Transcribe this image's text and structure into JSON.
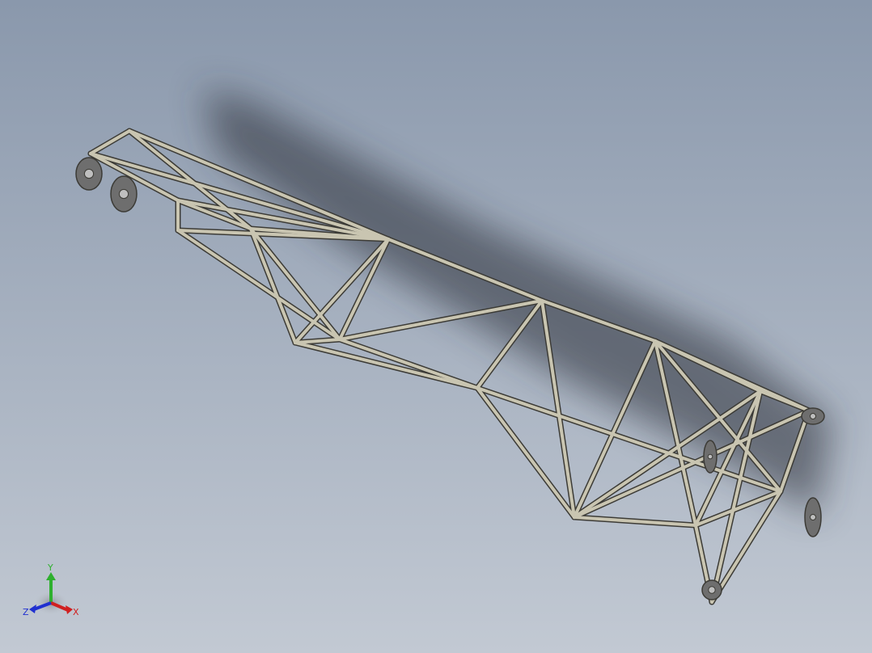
{
  "viewport": {
    "background_top": "#8a98ac",
    "background_bottom": "#c2c9d3"
  },
  "model": {
    "tube_color": "#c9c5b1",
    "tube_edge": "#3c3b36",
    "plate_color": "#6e6e6e"
  },
  "triad": {
    "y_label": "Y",
    "x_label": "X",
    "z_label": "Z",
    "y_color": "#2fb02f",
    "x_color": "#d02020",
    "z_color": "#2030d0"
  }
}
